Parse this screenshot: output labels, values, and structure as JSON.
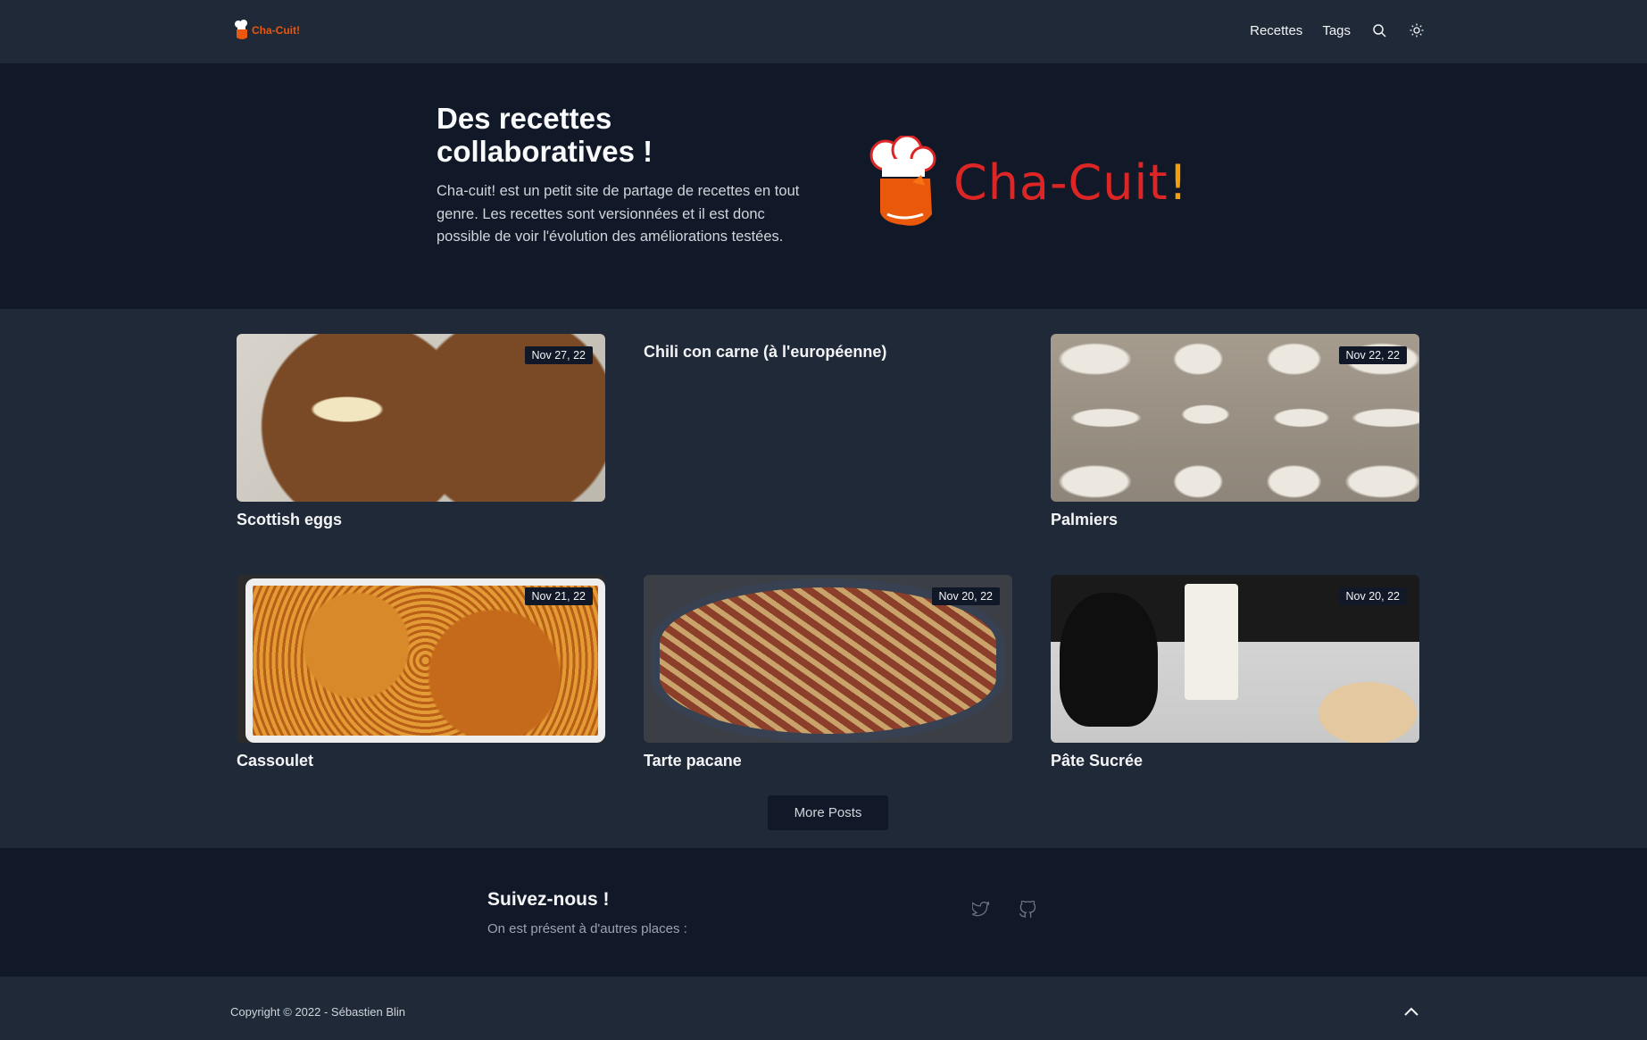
{
  "header": {
    "brand": "Cha-Cuit!",
    "nav": [
      "Recettes",
      "Tags"
    ],
    "icons": [
      "search-icon",
      "sun-icon"
    ]
  },
  "hero": {
    "title": "Des recettes collaboratives !",
    "description": "Cha-cuit! est un petit site de partage de recettes en tout genre. Les recettes sont versionnées et il est donc possible de voir l'évolution des améliorations testées.",
    "logo_text": "Cha-Cuit",
    "logo_excl": "!"
  },
  "posts": [
    {
      "title": "Scottish eggs",
      "date": "Nov 27, 22"
    },
    {
      "title": "Chili con carne (à l'européenne)",
      "date": ""
    },
    {
      "title": "Palmiers",
      "date": "Nov 22, 22"
    },
    {
      "title": "Cassoulet",
      "date": "Nov 21, 22"
    },
    {
      "title": "Tarte pacane",
      "date": "Nov 20, 22"
    },
    {
      "title": "Pâte Sucrée",
      "date": "Nov 20, 22"
    }
  ],
  "more_label": "More Posts",
  "follow": {
    "title": "Suivez-nous !",
    "subtitle": "On est présent à d'autres places :",
    "icons": [
      "twitter-icon",
      "github-icon"
    ]
  },
  "footer": {
    "copyright": "Copyright © 2022 - Sébastien Blin"
  },
  "colors": {
    "background": "#1f2937",
    "dark_band": "#111827",
    "brand_red": "#dc2626",
    "brand_orange": "#ea580c"
  }
}
